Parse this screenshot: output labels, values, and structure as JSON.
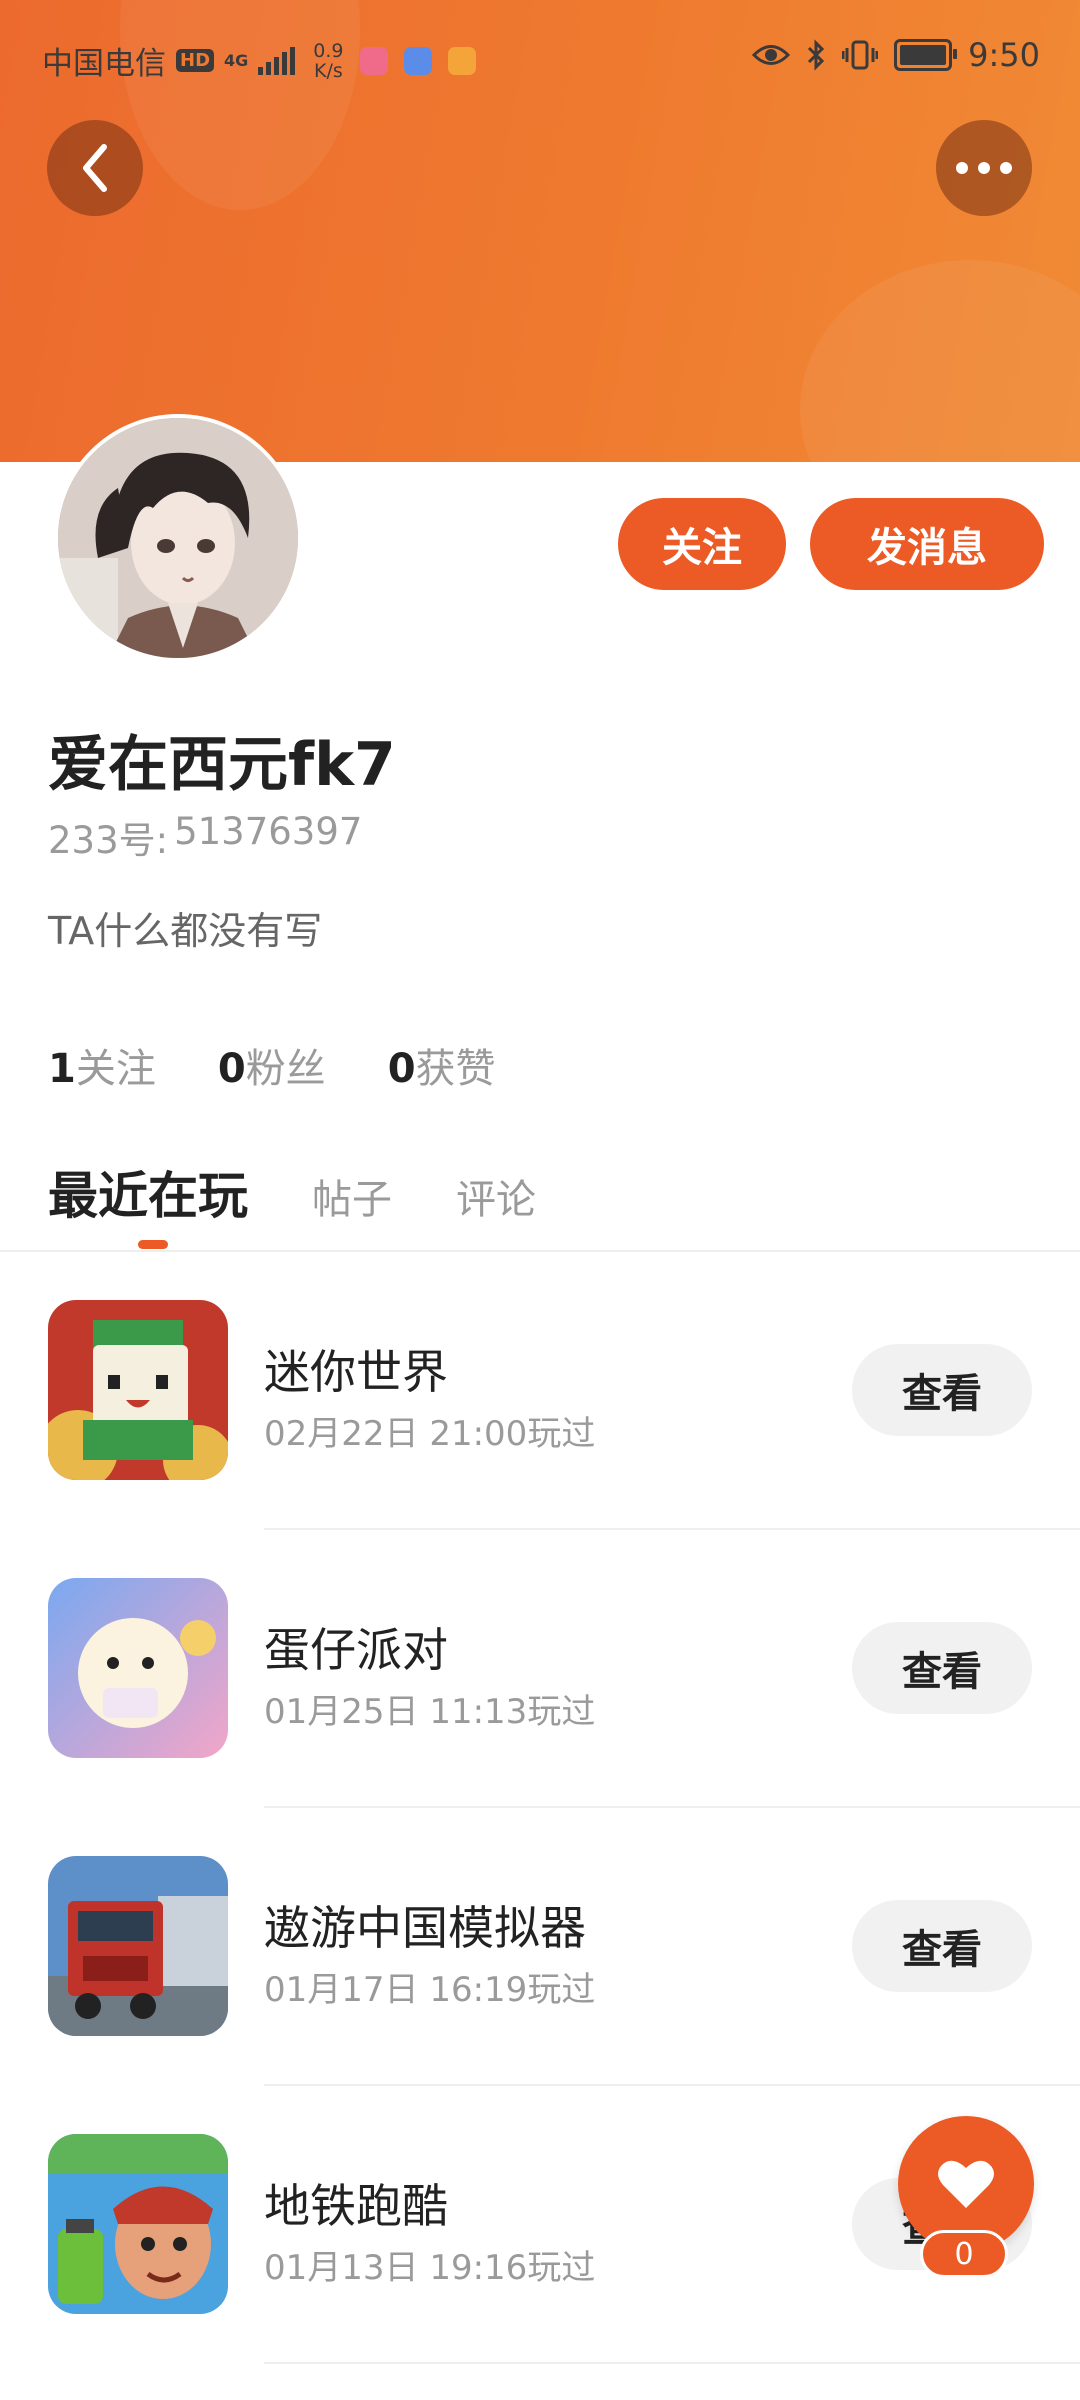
{
  "status_bar": {
    "carrier": "中国电信",
    "hd_badge": "HD",
    "network_type": "4G",
    "speed_value": "0.9",
    "speed_unit": "K/s",
    "time": "9:50"
  },
  "profile": {
    "username": "爱在西元fk7",
    "id_label": "233号:",
    "id_value": "51376397",
    "bio": "TA什么都没有写"
  },
  "actions": {
    "follow_label": "关注",
    "message_label": "发消息"
  },
  "stats": [
    {
      "num": "1",
      "label": "关注"
    },
    {
      "num": "0",
      "label": "粉丝"
    },
    {
      "num": "0",
      "label": "获赞"
    }
  ],
  "tabs": [
    {
      "label": "最近在玩",
      "active": true
    },
    {
      "label": "帖子",
      "active": false
    },
    {
      "label": "评论",
      "active": false
    }
  ],
  "games": [
    {
      "name": "迷你世界",
      "played": "02月22日 21:00玩过",
      "button": "查看"
    },
    {
      "name": "蛋仔派对",
      "played": "01月25日 11:13玩过",
      "button": "查看"
    },
    {
      "name": "遨游中国模拟器",
      "played": "01月17日 16:19玩过",
      "button": "查看"
    },
    {
      "name": "地铁跑酷",
      "played": "01月13日 19:16玩过",
      "button": "查看"
    }
  ],
  "fab": {
    "icon": "heart-icon",
    "count": "0"
  },
  "colors": {
    "accent": "#ec5a26",
    "banner": "#ef7a2f"
  }
}
